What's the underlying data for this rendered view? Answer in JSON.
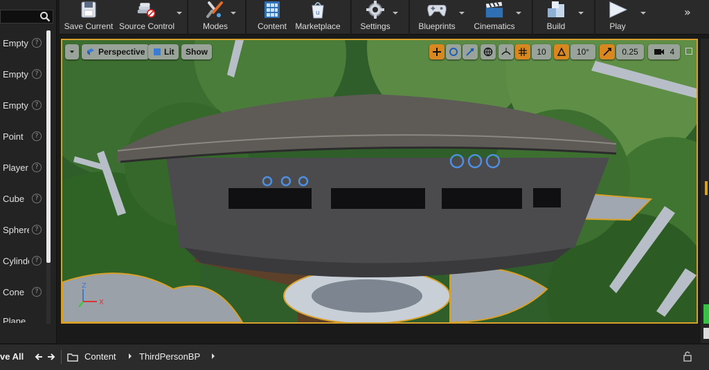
{
  "toolbar": {
    "buttons": [
      {
        "label": "Save Current"
      },
      {
        "label": "Source Control"
      },
      {
        "label": "Modes"
      },
      {
        "label": "Content"
      },
      {
        "label": "Marketplace"
      },
      {
        "label": "Settings"
      },
      {
        "label": "Blueprints"
      },
      {
        "label": "Cinematics"
      },
      {
        "label": "Build"
      },
      {
        "label": "Play"
      }
    ],
    "more_glyph": "»"
  },
  "place_actors": {
    "items": [
      {
        "label": "Empty"
      },
      {
        "label": "Empty"
      },
      {
        "label": "Empty"
      },
      {
        "label": "Point"
      },
      {
        "label": "Player"
      },
      {
        "label": "Cube"
      },
      {
        "label": "Sphere"
      },
      {
        "label": "Cylinder"
      },
      {
        "label": "Cone"
      },
      {
        "label": "Plane"
      }
    ],
    "help_glyph": "?"
  },
  "viewport": {
    "view_mode": "Perspective",
    "lighting": "Lit",
    "show": "Show",
    "grid_snap": "10",
    "rotation_snap": "10°",
    "scale_snap": "0.25",
    "camera_speed": "4",
    "axis_labels": {
      "x": "X",
      "z": "Z"
    },
    "accent_color": "#d7a02b"
  },
  "content_browser": {
    "save_all": "ve All",
    "crumbs": [
      "Content",
      "ThirdPersonBP"
    ]
  },
  "colors": {
    "selection_outline": "#d7a02b",
    "toolbar_bg": "#2a2a2a",
    "panel_bg": "#232323"
  }
}
